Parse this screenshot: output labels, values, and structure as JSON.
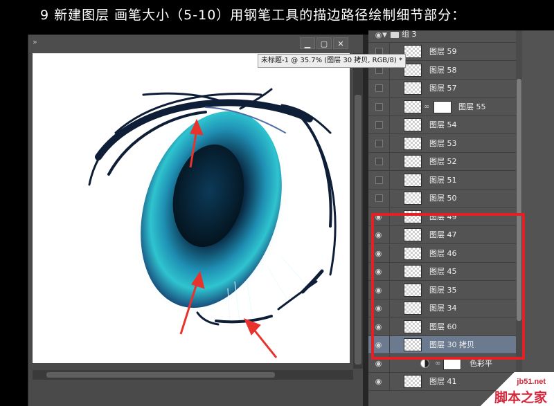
{
  "caption": "9 新建图层  画笔大小（5-10）用钢笔工具的描边路径绘制细节部分：",
  "document": {
    "tooltip": "未标题-1 @ 35.7% (图层 30 拷贝, RGB/8) *",
    "minimize_glyph": "▁",
    "restore_glyph": "▢",
    "close_glyph": "✕",
    "double_arrow": "»"
  },
  "layers": {
    "group_name": "组 3",
    "rows": [
      {
        "name": "图层 59",
        "visible": false
      },
      {
        "name": "图层 58",
        "visible": false
      },
      {
        "name": "图层 57",
        "visible": false
      },
      {
        "name": "图层 55",
        "visible": false,
        "mask": true
      },
      {
        "name": "图层 54",
        "visible": false
      },
      {
        "name": "图层 53",
        "visible": false
      },
      {
        "name": "图层 52",
        "visible": false
      },
      {
        "name": "图层 51",
        "visible": false
      },
      {
        "name": "图层 50",
        "visible": false
      },
      {
        "name": "图层 49",
        "visible": true
      },
      {
        "name": "图层 47",
        "visible": true
      },
      {
        "name": "图层 46",
        "visible": true
      },
      {
        "name": "图层 45",
        "visible": true
      },
      {
        "name": "图层 35",
        "visible": true
      },
      {
        "name": "图层 34",
        "visible": true
      },
      {
        "name": "图层 60",
        "visible": true
      },
      {
        "name": "图层 30 拷贝",
        "visible": true,
        "selected": true
      }
    ],
    "adjustment_name": "色彩平",
    "bottom_partial": "图层 41"
  },
  "watermark": {
    "site": "jb51.net",
    "name": "脚本之家"
  },
  "colors": {
    "highlight": "#e32026",
    "selected_row": "#6b7a8e",
    "panel_bg": "#535353",
    "eye_iris_light": "#2fc4cf",
    "eye_iris_dark": "#0c2a43",
    "lash": "#0e1e36",
    "annotation_arrow": "#e8332d"
  },
  "icons": {
    "eye": "eye-icon",
    "folder": "folder-icon",
    "chain": "chain-icon"
  }
}
